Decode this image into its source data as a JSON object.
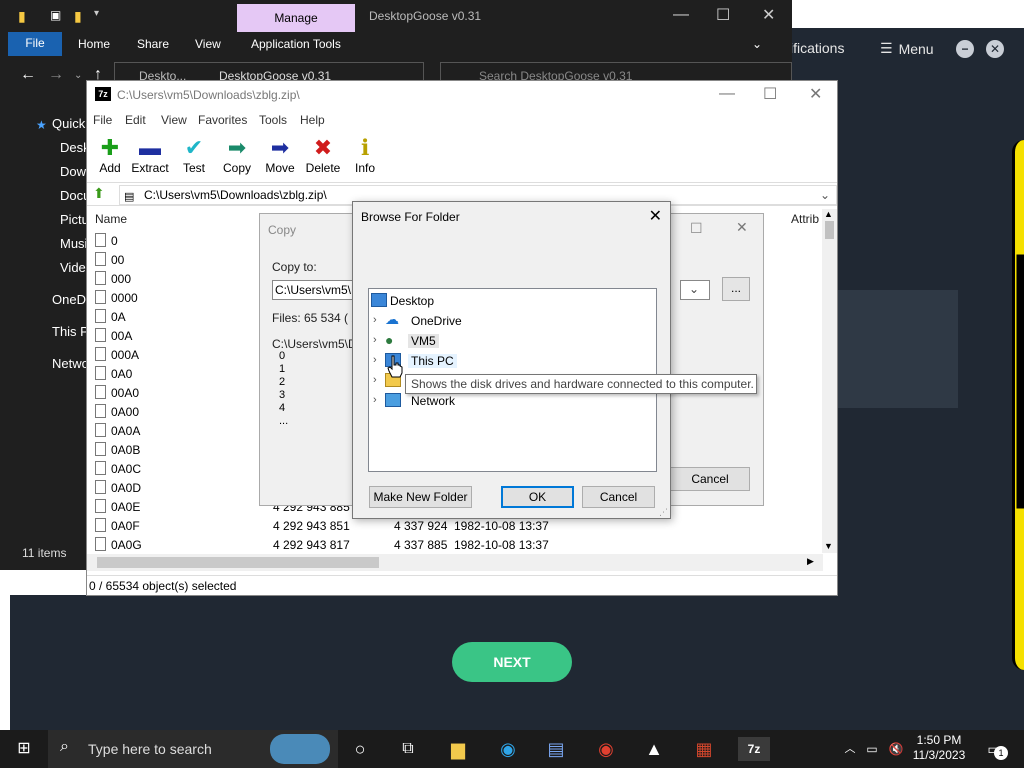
{
  "explorer": {
    "manage_tab": "Manage",
    "title": "DesktopGoose v0.31",
    "ribbon": {
      "file": "File",
      "home": "Home",
      "share": "Share",
      "view": "View",
      "app_tools": "Application Tools"
    },
    "address": "DesktopGoose v0.31",
    "address_parent": "Deskto...",
    "search_placeholder": "Search DesktopGoose v0.31",
    "nav": [
      "Quick",
      "Desk",
      "Dow",
      "Docu",
      "Pictu",
      "Musi",
      "Vide",
      "OneDr",
      "This P",
      "Netwo"
    ],
    "items_count": "11 items"
  },
  "bg_app": {
    "notifications": "ifications",
    "menu": "Menu",
    "next": "NEXT"
  },
  "zip": {
    "title": "C:\\Users\\vm5\\Downloads\\zblg.zip\\",
    "menu": [
      "File",
      "Edit",
      "View",
      "Favorites",
      "Tools",
      "Help"
    ],
    "toolbar": {
      "add": "Add",
      "extract": "Extract",
      "test": "Test",
      "copy": "Copy",
      "move": "Move",
      "delete": "Delete",
      "info": "Info"
    },
    "path": "C:\\Users\\vm5\\Downloads\\zblg.zip\\",
    "col_name": "Name",
    "col_attrib": "Attrib",
    "rows": [
      {
        "name": "0"
      },
      {
        "name": "00"
      },
      {
        "name": "000"
      },
      {
        "name": "0000"
      },
      {
        "name": "0A"
      },
      {
        "name": "00A"
      },
      {
        "name": "000A"
      },
      {
        "name": "0A0"
      },
      {
        "name": "00A0"
      },
      {
        "name": "0A00"
      },
      {
        "name": "0A0A"
      },
      {
        "name": "0A0B"
      },
      {
        "name": "0A0C"
      },
      {
        "name": "0A0D"
      },
      {
        "name": "0A0E",
        "size": "4 292 943 885"
      },
      {
        "name": "0A0F",
        "size": "4 292 943 851",
        "packed": "4 337 924",
        "date": "1982-10-08 13:37"
      },
      {
        "name": "0A0G",
        "size": "4 292 943 817",
        "packed": "4 337 885",
        "date": "1982-10-08 13:37"
      }
    ],
    "status": "0 / 65534 object(s) selected"
  },
  "copy_dialog": {
    "title": "Copy",
    "copy_to_label": "Copy to:",
    "copy_to_value": "C:\\Users\\vm5\\D",
    "files": "Files: 65 534   ( 2",
    "source": "C:\\Users\\vm5\\D",
    "entries": [
      "0",
      "1",
      "2",
      "3",
      "4",
      "..."
    ],
    "browse": "...",
    "cancel": "Cancel"
  },
  "browse_dialog": {
    "title": "Browse For Folder",
    "tree": {
      "desktop": "Desktop",
      "onedrive": "OneDrive",
      "vm5": "VM5",
      "thispc": "This PC",
      "network": "Network"
    },
    "tooltip": "Shows the disk drives and hardware connected to this computer.",
    "new_folder": "Make New Folder",
    "ok": "OK",
    "cancel": "Cancel"
  },
  "taskbar": {
    "search_placeholder": "Type here to search",
    "time": "1:50 PM",
    "date": "11/3/2023",
    "notif_count": "1"
  }
}
